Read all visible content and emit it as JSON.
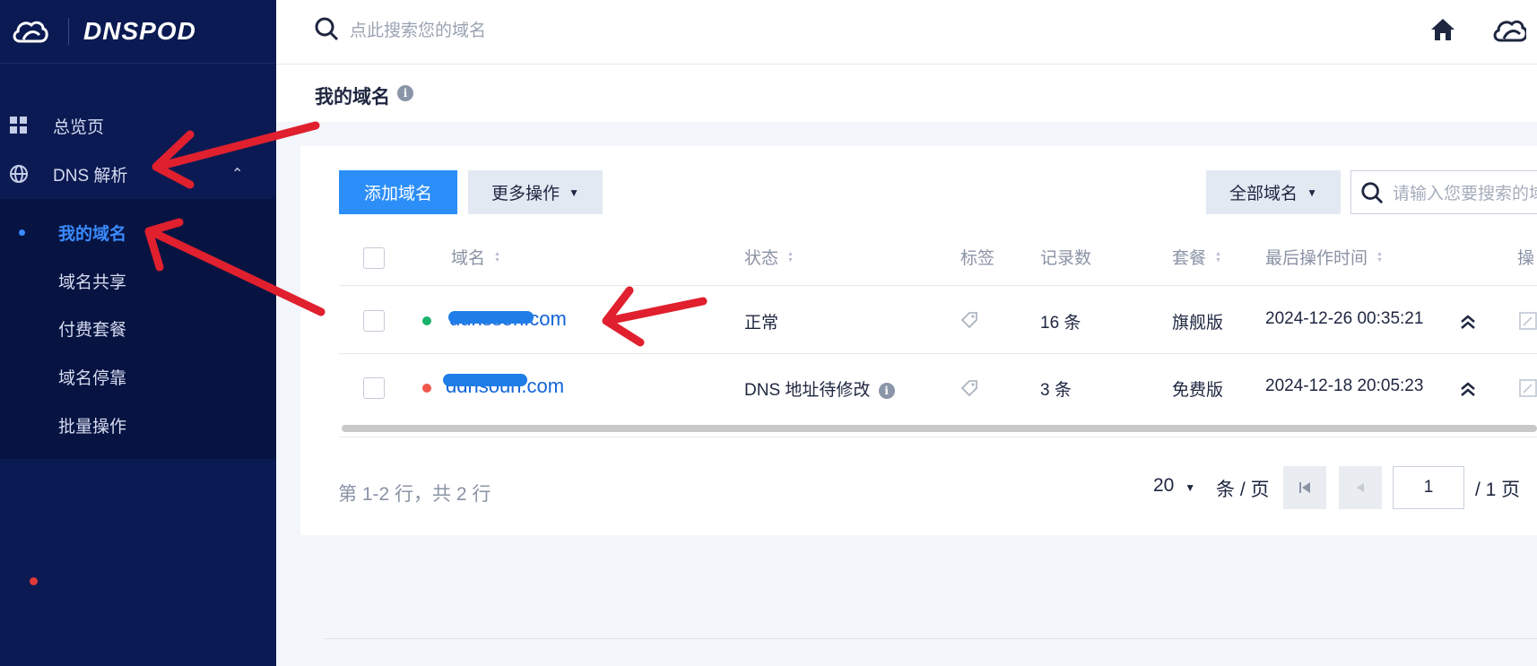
{
  "app": {
    "brand": "DNSPOD"
  },
  "sidebar": {
    "items": [
      {
        "label": "总览页",
        "icon": "dashboard-grid-icon"
      },
      {
        "label": "DNS 解析",
        "icon": "globe-icon",
        "expanded": true
      }
    ],
    "sub_items": [
      {
        "label": "我的域名",
        "active": true
      },
      {
        "label": "域名共享"
      },
      {
        "label": "付费套餐"
      },
      {
        "label": "域名停靠"
      },
      {
        "label": "批量操作"
      }
    ]
  },
  "topbar": {
    "search_placeholder": "点此搜索您的域名"
  },
  "page": {
    "title": "我的域名"
  },
  "toolbar": {
    "add_label": "添加域名",
    "more_label": "更多操作",
    "filter_label": "全部域名",
    "search_placeholder": "请输入您要搜索的域"
  },
  "table": {
    "headers": {
      "domain": "域名",
      "status": "状态",
      "tag": "标签",
      "records": "记录数",
      "plan": "套餐",
      "last_op": "最后操作时间",
      "ops": "操"
    },
    "rows": [
      {
        "domain": "ddnssoh.com",
        "status": "正常",
        "status_color": "#19b36b",
        "records": "16 条",
        "plan": "旗舰版",
        "last_op": "2024-12-26 00:35:21"
      },
      {
        "domain": "ddnsoun.com",
        "status": "DNS 地址待修改",
        "status_color": "#f0574a",
        "records": "3 条",
        "plan": "免费版",
        "last_op": "2024-12-18 20:05:23"
      }
    ]
  },
  "pagination": {
    "summary": "第 1-2 行，共 2 行",
    "page_size": "20",
    "per_page_label": "条 / 页",
    "current_page": "1",
    "total_label": "/ 1 页"
  },
  "colors": {
    "sidebar_bg": "#0b1a52",
    "accent": "#2c8ef8",
    "link": "#1264d6",
    "annotation_arrow": "#e0202e"
  }
}
